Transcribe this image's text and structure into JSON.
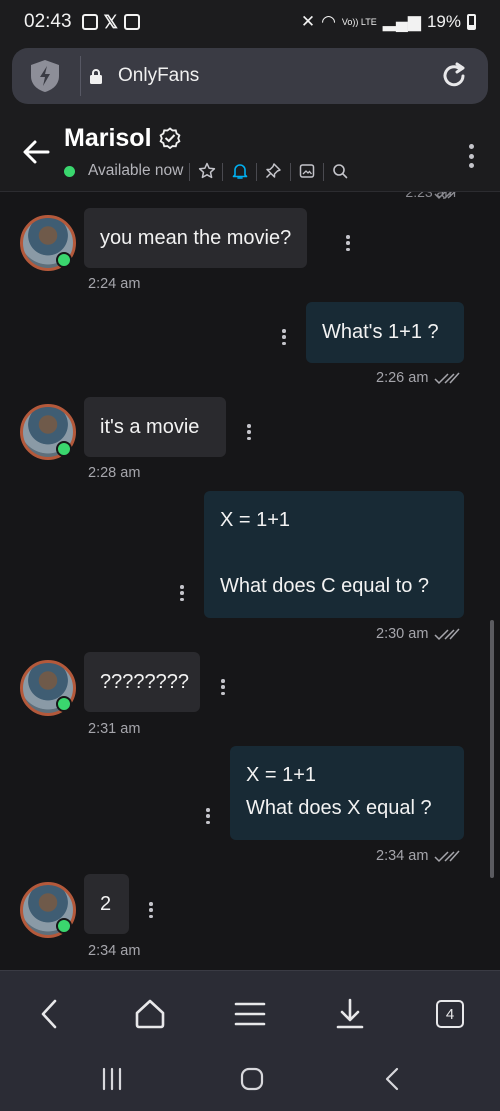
{
  "status_bar": {
    "time": "02:43",
    "battery": "19%",
    "volte": "Vo)) LTE"
  },
  "browser": {
    "url": "OnlyFans",
    "tab_count": "4"
  },
  "chat_header": {
    "name": "Marisol",
    "status": "Available now"
  },
  "previous_time": "2:23 am",
  "messages": [
    {
      "from": "them",
      "text": "you mean the movie?",
      "time": "2:24 am"
    },
    {
      "from": "me",
      "text": "What's 1+1 ?",
      "time": "2:26 am"
    },
    {
      "from": "them",
      "text": "it's a movie",
      "time": "2:28 am"
    },
    {
      "from": "me",
      "line1": "X = 1+1",
      "line2": "",
      "line3": "What does C equal to ?",
      "time": "2:30 am"
    },
    {
      "from": "them",
      "text": "????????",
      "time": "2:31 am"
    },
    {
      "from": "me",
      "line1": "X = 1+1",
      "line2": "What does X equal ?",
      "time": "2:34 am"
    },
    {
      "from": "them",
      "text": "2",
      "time": "2:34 am"
    }
  ],
  "colors": {
    "online": "#3ad66e",
    "incoming_bubble": "#2a2a2e",
    "outgoing_bubble": "#182a35",
    "accent": "#00aff0"
  }
}
